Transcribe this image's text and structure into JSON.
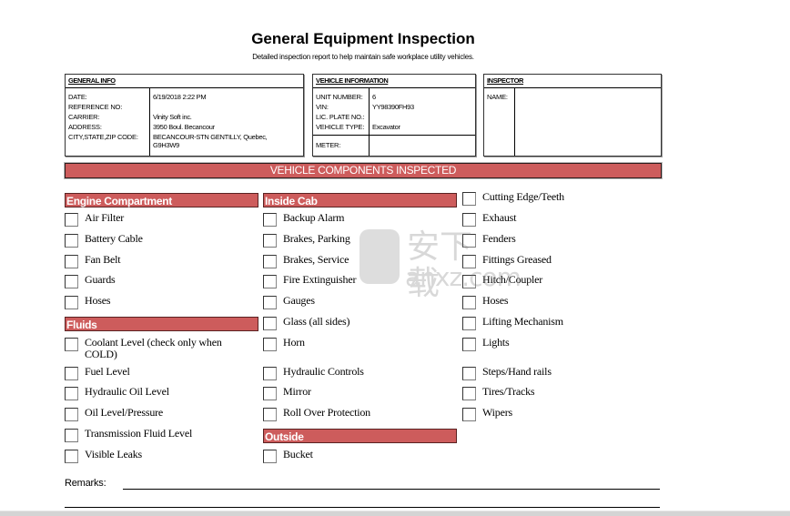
{
  "document": {
    "title": "General Equipment Inspection",
    "subtitle": "Detailed inspection report to help maintain safe workplace utility vehicles."
  },
  "general_info": {
    "header": "GENERAL INFO",
    "fields": [
      {
        "label": "DATE:",
        "value": "6/19/2018 2:22 PM"
      },
      {
        "label": "REFERENCE NO:",
        "value": ""
      },
      {
        "label": "CARRIER:",
        "value": "Vinity Soft inc."
      },
      {
        "label": "ADDRESS:",
        "value": "3950 Boul. Becancour"
      },
      {
        "label": "CITY,STATE,ZIP CODE:",
        "value": "BECANCOUR-STN GENTILLY, Quebec, G9H3W9"
      }
    ]
  },
  "vehicle_info": {
    "header": "VEHICLE INFORMATION",
    "fields": [
      {
        "label": "UNIT NUMBER:",
        "value": "6"
      },
      {
        "label": "VIN:",
        "value": "YY98390FH93"
      },
      {
        "label": "LIC. PLATE NO.:",
        "value": ""
      },
      {
        "label": "VEHICLE TYPE:",
        "value": "Excavator"
      }
    ],
    "meter": {
      "label": "METER:",
      "value": ""
    }
  },
  "inspector": {
    "header": "INSPECTOR",
    "name_label": "NAME:",
    "name_value": ""
  },
  "banner": "VEHICLE COMPONENTS INSPECTED",
  "sections": {
    "engine": {
      "title": "Engine Compartment",
      "items": [
        {
          "label": "Air Filter",
          "checked": false
        },
        {
          "label": "Battery Cable",
          "checked": false
        },
        {
          "label": "Fan Belt",
          "checked": false
        },
        {
          "label": "Guards",
          "checked": false
        },
        {
          "label": "Hoses",
          "checked": false
        }
      ]
    },
    "fluids": {
      "title": "Fluids",
      "items": [
        {
          "label": "Coolant Level (check only when COLD)",
          "checked": false
        },
        {
          "label": "Fuel Level",
          "checked": false
        },
        {
          "label": "Hydraulic Oil Level",
          "checked": false
        },
        {
          "label": "Oil Level/Pressure",
          "checked": false
        },
        {
          "label": "Transmission Fluid Level",
          "checked": false
        },
        {
          "label": "Visible Leaks",
          "checked": false
        }
      ]
    },
    "cab": {
      "title": "Inside Cab",
      "items": [
        {
          "label": "Backup Alarm",
          "checked": false
        },
        {
          "label": "Brakes, Parking",
          "checked": false
        },
        {
          "label": "Brakes, Service",
          "checked": false
        },
        {
          "label": "Fire Extinguisher",
          "checked": false
        },
        {
          "label": "Gauges",
          "checked": false
        },
        {
          "label": "Glass (all sides)",
          "checked": false
        },
        {
          "label": "Horn",
          "checked": false
        },
        {
          "label": "Hydraulic Controls",
          "checked": false
        },
        {
          "label": "Mirror",
          "checked": false
        },
        {
          "label": "Roll Over Protection",
          "checked": false
        }
      ]
    },
    "outside": {
      "title": "Outside",
      "items": [
        {
          "label": "Bucket",
          "checked": false
        }
      ]
    },
    "other": {
      "items": [
        {
          "label": "Cutting Edge/Teeth",
          "checked": false
        },
        {
          "label": "Exhaust",
          "checked": false
        },
        {
          "label": "Fenders",
          "checked": false
        },
        {
          "label": "Fittings Greased",
          "checked": false
        },
        {
          "label": "Hitch/Coupler",
          "checked": false
        },
        {
          "label": "Hoses",
          "checked": false
        },
        {
          "label": "Lifting Mechanism",
          "checked": false
        },
        {
          "label": "Lights",
          "checked": false
        },
        {
          "label": "Steps/Hand rails",
          "checked": false
        },
        {
          "label": "Tires/Tracks",
          "checked": false
        },
        {
          "label": "Wipers",
          "checked": false
        }
      ]
    }
  },
  "remarks": {
    "label": "Remarks:",
    "value": ""
  },
  "watermark": {
    "glyphs": "安下载",
    "url": "anxz.com"
  },
  "colors": {
    "section_fill": "#cd5c5c",
    "section_text": "#ffffff"
  }
}
